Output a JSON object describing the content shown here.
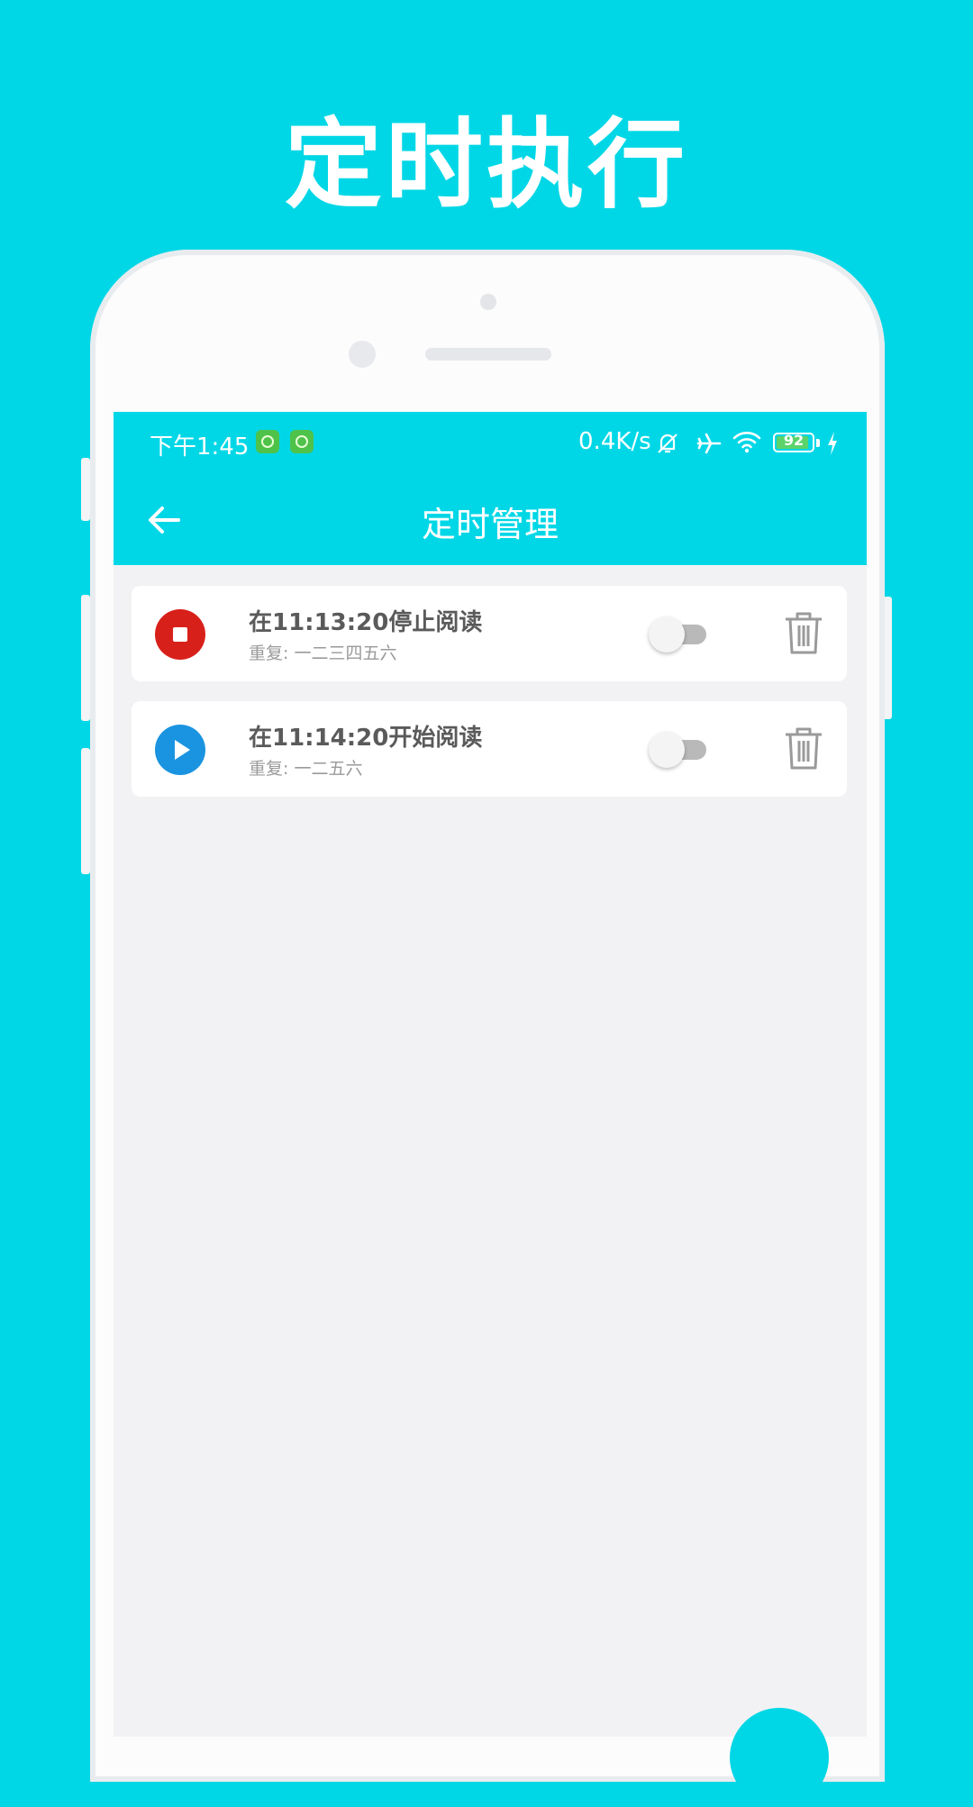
{
  "headline": "定时执行",
  "statusbar": {
    "time": "下午1:45",
    "net_speed": "0.4K/s",
    "battery": "92",
    "battery_level": 0.92,
    "icons": [
      "app-icon",
      "app-icon",
      "bell-off-icon",
      "airplane-icon",
      "wifi-icon",
      "battery-icon",
      "charging-icon"
    ]
  },
  "toolbar": {
    "title": "定时管理",
    "back_icon": "arrow-left-icon"
  },
  "timers": [
    {
      "title": "在11:13:20停止阅读",
      "repeat": "重复: 一二三四五六",
      "action": "stop",
      "action_icon": "stop-icon",
      "action_color": "#d8201b",
      "enabled": false
    },
    {
      "title": "在11:14:20开始阅读",
      "repeat": "重复: 一二五六",
      "action": "start",
      "action_icon": "play-icon",
      "action_color": "#1a94e0",
      "enabled": false
    }
  ],
  "colors": {
    "accent": "#00d7e6",
    "background": "#f2f2f4"
  }
}
